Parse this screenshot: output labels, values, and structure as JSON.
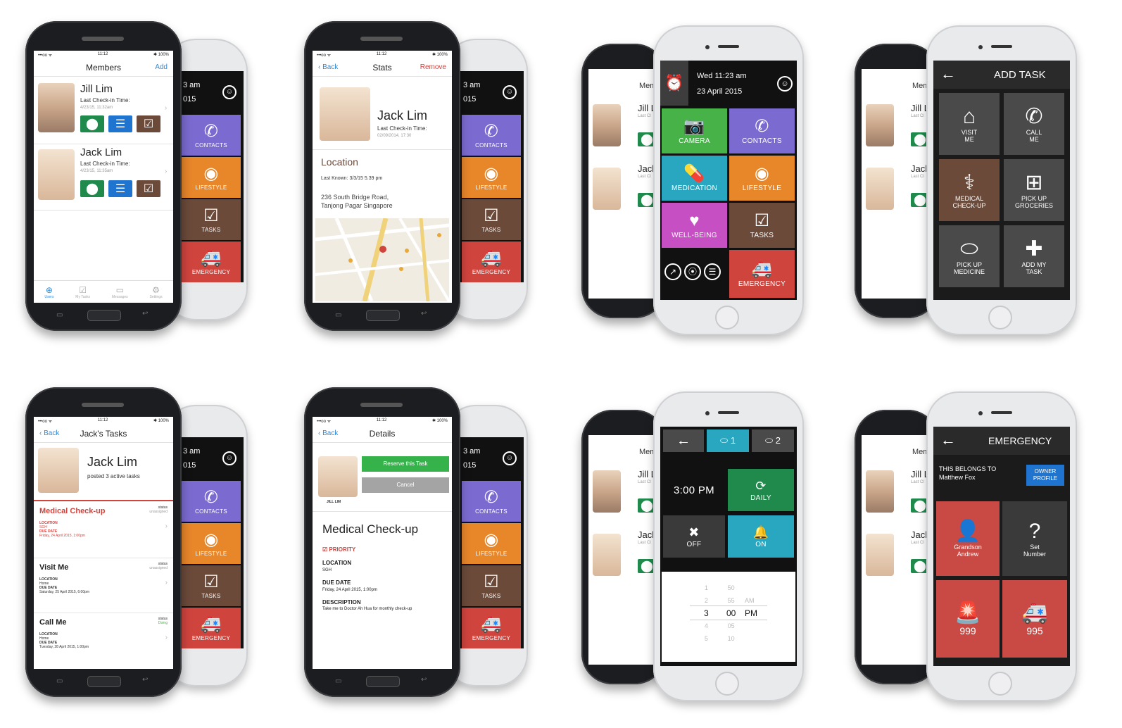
{
  "p1": {
    "status": {
      "carrier": "•••oo ᯤ",
      "time": "11:12",
      "battery": "✱ 100%"
    },
    "title": "Members",
    "add": "Add",
    "members": [
      {
        "name": "Jill Lim",
        "checkin_label": "Last Check-in Time:",
        "checkin": "4/23/15, 11:32am"
      },
      {
        "name": "Jack Lim",
        "checkin_label": "Last Check-in Time:",
        "checkin": "4/23/15, 11:35am"
      }
    ],
    "tabs": [
      "Users",
      "My Tasks",
      "Messages",
      "Settings"
    ]
  },
  "back": {
    "time": "3 am",
    "year": "015",
    "tiles": [
      "CONTACTS",
      "LIFESTYLE",
      "TASKS",
      "EMERGENCY"
    ]
  },
  "p2": {
    "status": {
      "carrier": "•••oo ᯤ",
      "time": "11:12",
      "battery": "✱ 100%"
    },
    "back": "Back",
    "title": "Stats",
    "remove": "Remove",
    "name": "Jack Lim",
    "checkin_label": "Last Check-in Time:",
    "checkin": "02/09/2014, 17:30",
    "location_h": "Location",
    "last_known": "Last Known: 3/3/15 5.39 pm",
    "address": [
      "236 South Bridge Road,",
      "Tanjong Pagar Singapore"
    ]
  },
  "p3": {
    "peek_title": "Mem",
    "peek_names": [
      "Jill Li",
      "Jack"
    ],
    "peek_line": "Last Cl",
    "date": "Wed 11:23 am",
    "date2": "23 April 2015",
    "tiles": [
      "CAMERA",
      "CONTACTS",
      "MEDICATION",
      "LIFESTYLE",
      "WELL-BEING",
      "TASKS",
      "EMERGENCY"
    ]
  },
  "p4": {
    "title": "ADD TASK",
    "tiles": [
      [
        "VISIT",
        "ME"
      ],
      [
        "CALL",
        "ME"
      ],
      [
        "MEDICAL",
        "CHECK-UP"
      ],
      [
        "PICK UP",
        "GROCERIES"
      ],
      [
        "PICK UP",
        "MEDICINE"
      ],
      [
        "ADD MY",
        "TASK"
      ]
    ]
  },
  "p5": {
    "status": {
      "carrier": "•••oo ᯤ",
      "time": "11:12",
      "battery": "✱ 100%"
    },
    "back": "Back",
    "title": "Jack's Tasks",
    "name": "Jack Lim",
    "posted": "posted 3 active tasks",
    "tasks": [
      {
        "title": "Medical Check-up",
        "status_l": "status",
        "status": "unassigned",
        "loc_l": "LOCATION",
        "loc": "SGH",
        "due_l": "DUE DATE",
        "due": "Friday, 24 April 2015, 1:00pm"
      },
      {
        "title": "Visit Me",
        "status_l": "status",
        "status": "unassigned",
        "loc_l": "LOCATION",
        "loc": "Home",
        "due_l": "DUE DATE",
        "due": "Saturday, 25 April 2015, 6:00pm"
      },
      {
        "title": "Call Me",
        "status_l": "status",
        "status": "Doing",
        "loc_l": "LOCATION",
        "loc": "Home",
        "due_l": "DUE DATE",
        "due": "Tuesday, 28 April 2015, 1:00pm"
      }
    ]
  },
  "p6": {
    "status": {
      "carrier": "•••oo ᯤ",
      "time": "11:12",
      "battery": "✱ 100%"
    },
    "back": "Back",
    "title": "Details",
    "reserve": "Reserve this Task",
    "cancel": "Cancel",
    "avatar_name": "JILL LIM",
    "task": "Medical Check-up",
    "priority": "PRIORITY",
    "loc_l": "LOCATION",
    "loc": "SGH",
    "due_l": "DUE DATE",
    "due": "Friday, 24 April 2015, 1:00pm",
    "desc_l": "DESCRIPTION",
    "desc": "Take me to Doctor Ah Hua for monthly check-up"
  },
  "p7": {
    "pill1": "1",
    "pill2": "2",
    "time": "3:00 PM",
    "daily": "DAILY",
    "off": "OFF",
    "on": "ON",
    "picker": {
      "hours": [
        "1",
        "2",
        "3",
        "4",
        "5"
      ],
      "mins": [
        "50",
        "55",
        "00",
        "05",
        "10"
      ],
      "ampm": [
        "AM",
        "PM"
      ]
    }
  },
  "p8": {
    "title": "EMERGENCY",
    "belongs": "THIS BELONGS TO",
    "owner": "Matthew Fox",
    "owner_btn": "OWNER PROFILE",
    "tiles": [
      [
        "Grandson",
        "Andrew"
      ],
      [
        "Set",
        "Number"
      ],
      [
        "999"
      ],
      [
        "995"
      ]
    ]
  },
  "colors": {
    "purple": "#7b6bd1",
    "orange": "#e8862a",
    "brown": "#6b4a3a",
    "red": "#d0443e",
    "green": "#46b248",
    "teal": "#2aa7c0",
    "magenta": "#c64fc4",
    "dkgreen": "#1f8a4c",
    "panel": "#4a4a4a",
    "ios_blue": "#2e8bd8"
  }
}
